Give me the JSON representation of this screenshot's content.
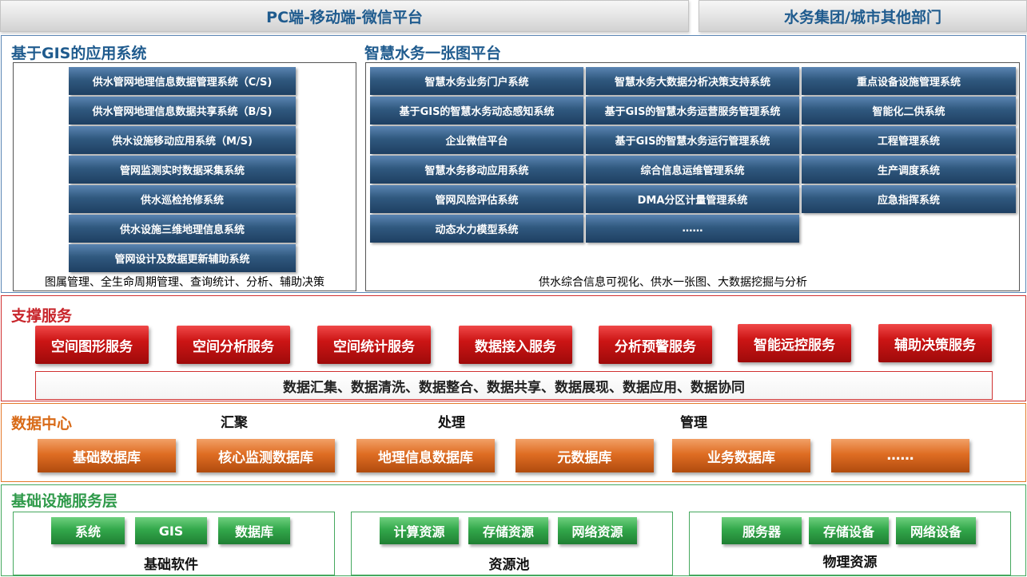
{
  "top": {
    "left_title": "PC端-移动端-微信平台",
    "right_title": "水务集团/城市其他部门"
  },
  "gis": {
    "title": "基于GIS的应用系统",
    "items": [
      "供水管网地理信息数据管理系统（C/S)",
      "供水管网地理信息数据共享系统（B/S)",
      "供水设施移动应用系统（M/S)",
      "管网监测实时数据采集系统",
      "供水巡检抢修系统",
      "供水设施三维地理信息系统",
      "管网设计及数据更新辅助系统"
    ],
    "caption": "图属管理、全生命周期管理、查询统计、分析、辅助决策"
  },
  "smart": {
    "title": "智慧水务一张图平台",
    "col1": [
      "智慧水务业务门户系统",
      "基于GIS的智慧水务动态感知系统",
      "企业微信平台",
      "智慧水务移动应用系统",
      "管网风险评估系统",
      "动态水力模型系统"
    ],
    "col2": [
      "智慧水务大数据分析决策支持系统",
      "基于GIS的智慧水务运营服务管理系统",
      "基于GIS的智慧水务运行管理系统",
      "综合信息运维管理系统",
      "DMA分区计量管理系统",
      "……"
    ],
    "col3": [
      "重点设备设施管理系统",
      "智能化二供系统",
      "工程管理系统",
      "生产调度系统",
      "应急指挥系统"
    ],
    "caption": "供水综合信息可视化、供水一张图、大数据挖掘与分析"
  },
  "support": {
    "title": "支撑服务",
    "services": [
      "空间图形服务",
      "空间分析服务",
      "空间统计服务",
      "数据接入服务",
      "分析预警服务",
      "智能远控服务",
      "辅助决策服务"
    ],
    "strip": "数据汇集、数据清洗、数据整合、数据共享、数据展现、数据应用、数据协同"
  },
  "datacenter": {
    "title": "数据中心",
    "labels": [
      "汇聚",
      "处理",
      "管理"
    ],
    "databases": [
      "基础数据库",
      "核心监测数据库",
      "地理信息数据库",
      "元数据库",
      "业务数据库",
      "……"
    ]
  },
  "infra": {
    "title": "基础设施服务层",
    "groups": [
      {
        "items": [
          "系统",
          "GIS",
          "数据库"
        ],
        "label": "基础软件"
      },
      {
        "items": [
          "计算资源",
          "存储资源",
          "网络资源"
        ],
        "label": "资源池"
      },
      {
        "items": [
          "服务器",
          "存储设备",
          "网络设备"
        ],
        "label": "物理资源"
      }
    ]
  },
  "colors": {
    "blue": "#1f5b8e",
    "red": "#c8262c",
    "orange": "#d86a17",
    "green": "#2f9a4a"
  }
}
